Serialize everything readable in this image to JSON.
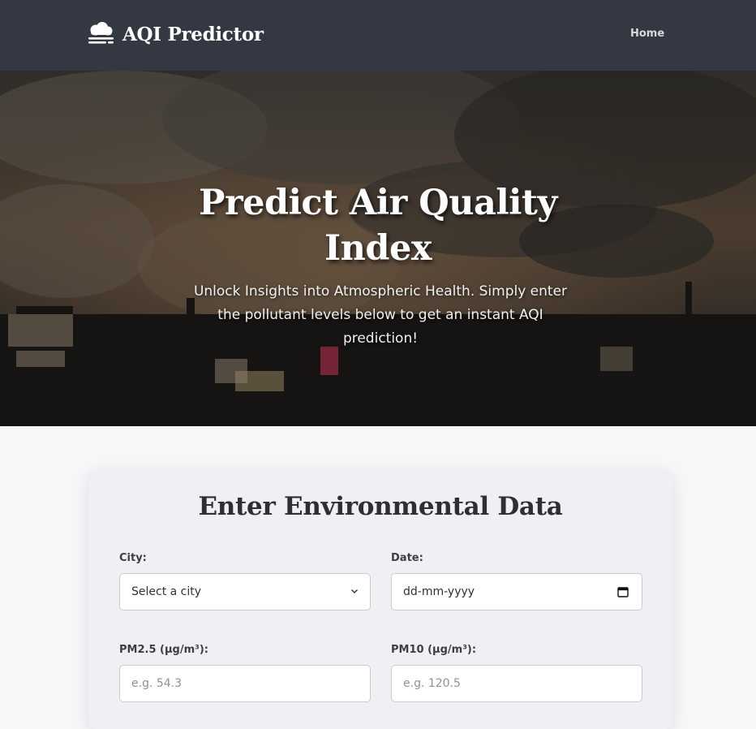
{
  "brand": {
    "name": "AQI Predictor",
    "icon": "smog-icon"
  },
  "nav": {
    "home_label": "Home"
  },
  "hero": {
    "title": "Predict Air Quality Index",
    "subtitle": "Unlock Insights into Atmospheric Health. Simply enter the pollutant levels below to get an instant AQI prediction!"
  },
  "form": {
    "title": "Enter Environmental Data",
    "city": {
      "label": "City:",
      "value": "Select a city",
      "icon": "chevron-down-icon"
    },
    "date": {
      "label": "Date:",
      "value": "dd-mm-yyyy",
      "icon": "calendar-icon"
    },
    "pm25": {
      "label": "PM2.5 (µg/m³):",
      "placeholder": "e.g. 54.3"
    },
    "pm10": {
      "label": "PM10 (µg/m³):",
      "placeholder": "e.g. 120.5"
    }
  },
  "colors": {
    "navbar": "#333842",
    "page_background": "#f6f7f9",
    "card_background": "#eef0f3",
    "title_text": "#2d2f33"
  }
}
